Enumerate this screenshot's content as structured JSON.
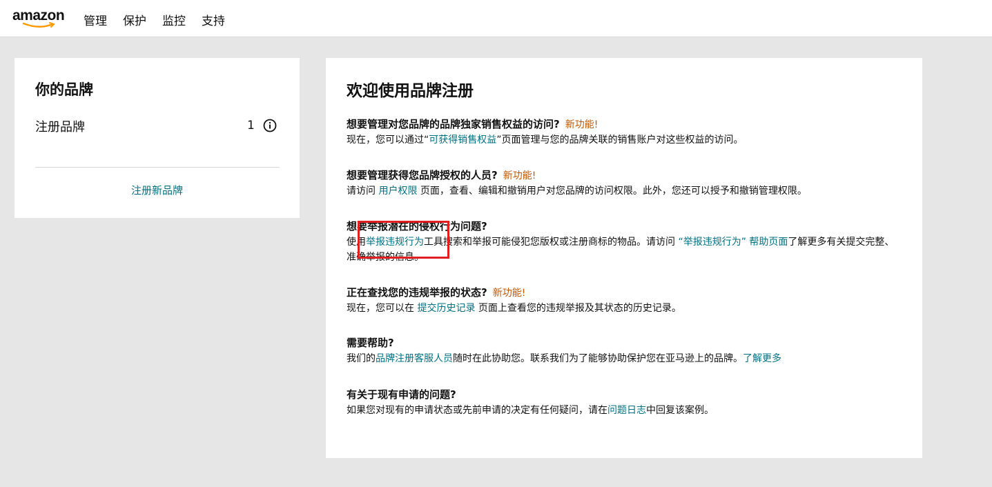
{
  "header": {
    "logo_text": "amazon",
    "nav": [
      "管理",
      "保护",
      "监控",
      "支持"
    ]
  },
  "brands": {
    "title": "你的品牌",
    "registered_label": "注册品牌",
    "registered_count": "1",
    "register_new": "注册新品牌"
  },
  "welcome": {
    "title": "欢迎使用品牌注册",
    "new_badge": "新功能!",
    "s1": {
      "question": "想要管理对您品牌的品牌独家销售权益的访问?",
      "text_a": "现在，您可以通过“",
      "link": "可获得销售权益",
      "text_b": "”页面管理与您的品牌关联的销售账户对这些权益的访问。"
    },
    "s2": {
      "question": "想要管理获得您品牌授权的人员?",
      "text_a": "请访问 ",
      "link": "用户权限",
      "text_b": " 页面，查看、编辑和撤销用户对您品牌的访问权限。此外，您还可以授予和撤销管理权限。"
    },
    "s3": {
      "question": "想要举报潜在的侵权行为问题?",
      "text_a": "使用",
      "link": "举报违规行为",
      "text_b": "工具搜索和举报可能侵犯您版权或注册商标的物品。请访问 ",
      "link2": "“举报违规行为” 帮助页面",
      "text_c": "了解更多有关提交完整、准确举报的信息。"
    },
    "s4": {
      "question": "正在查找您的违规举报的状态?",
      "text_a": "现在，您可以在 ",
      "link": "提交历史记录",
      "text_b": " 页面上查看您的违规举报及其状态的历史记录。"
    },
    "s5": {
      "question": "需要帮助?",
      "text_a": "我们的",
      "link": "品牌注册客服人员",
      "text_b": "随时在此协助您。联系我们为了能够协助保护您在亚马逊上的品牌。",
      "link2": "了解更多"
    },
    "s6": {
      "question": "有关于现有申请的问题?",
      "text_a": "如果您对现有的申请状态或先前申请的决定有任何疑问，请在",
      "link": "问题日志",
      "text_b": "中回复该案例。"
    }
  },
  "colors": {
    "link": "#007185",
    "new_badge": "#c45500",
    "highlight": "#e02020",
    "background": "#e6e6e6"
  }
}
